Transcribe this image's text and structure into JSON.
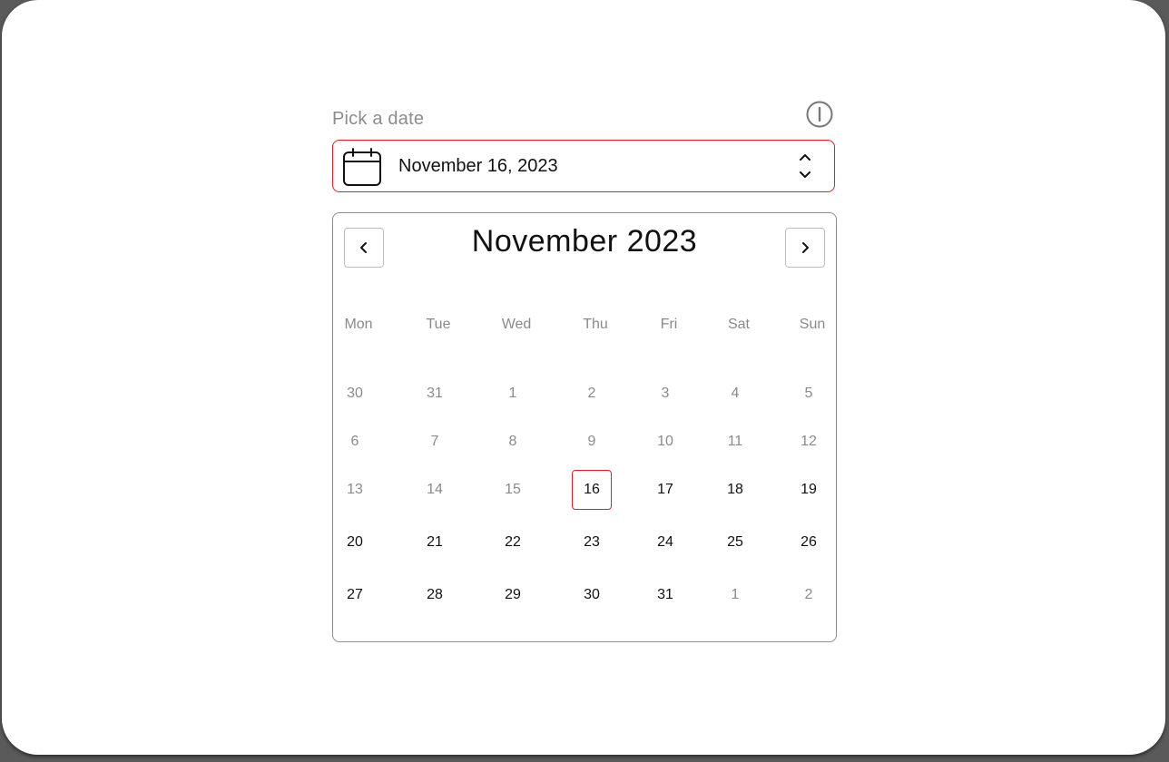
{
  "field": {
    "label": "Pick a date",
    "value": "November 16, 2023"
  },
  "icons": {
    "calendar": "calendar-icon",
    "stepper": "chevron-up-down-icon",
    "power": "power-icon",
    "prev": "chevron-left-icon",
    "next": "chevron-right-icon"
  },
  "colors": {
    "accent": "#e0202a",
    "muted_text": "#8a8a8a",
    "text": "#111111"
  },
  "calendar": {
    "title": "November 2023",
    "weekdays": [
      "Mon",
      "Tue",
      "Wed",
      "Thu",
      "Fri",
      "Sat",
      "Sun"
    ],
    "weeks": [
      [
        {
          "label": "30",
          "state": "muted"
        },
        {
          "label": "31",
          "state": "muted"
        },
        {
          "label": "1",
          "state": "muted"
        },
        {
          "label": "2",
          "state": "muted"
        },
        {
          "label": "3",
          "state": "muted"
        },
        {
          "label": "4",
          "state": "muted"
        },
        {
          "label": "5",
          "state": "muted"
        }
      ],
      [
        {
          "label": "6",
          "state": "muted"
        },
        {
          "label": "7",
          "state": "muted"
        },
        {
          "label": "8",
          "state": "muted"
        },
        {
          "label": "9",
          "state": "muted"
        },
        {
          "label": "10",
          "state": "muted"
        },
        {
          "label": "11",
          "state": "muted"
        },
        {
          "label": "12",
          "state": "muted"
        }
      ],
      [
        {
          "label": "13",
          "state": "muted"
        },
        {
          "label": "14",
          "state": "muted"
        },
        {
          "label": "15",
          "state": "muted"
        },
        {
          "label": "16",
          "state": "selected"
        },
        {
          "label": "17",
          "state": "active"
        },
        {
          "label": "18",
          "state": "active"
        },
        {
          "label": "19",
          "state": "active"
        }
      ],
      [
        {
          "label": "20",
          "state": "active"
        },
        {
          "label": "21",
          "state": "active"
        },
        {
          "label": "22",
          "state": "active"
        },
        {
          "label": "23",
          "state": "active"
        },
        {
          "label": "24",
          "state": "active"
        },
        {
          "label": "25",
          "state": "active"
        },
        {
          "label": "26",
          "state": "active"
        }
      ],
      [
        {
          "label": "27",
          "state": "active"
        },
        {
          "label": "28",
          "state": "active"
        },
        {
          "label": "29",
          "state": "active"
        },
        {
          "label": "30",
          "state": "active"
        },
        {
          "label": "31",
          "state": "active"
        },
        {
          "label": "1",
          "state": "muted"
        },
        {
          "label": "2",
          "state": "muted"
        }
      ]
    ]
  }
}
